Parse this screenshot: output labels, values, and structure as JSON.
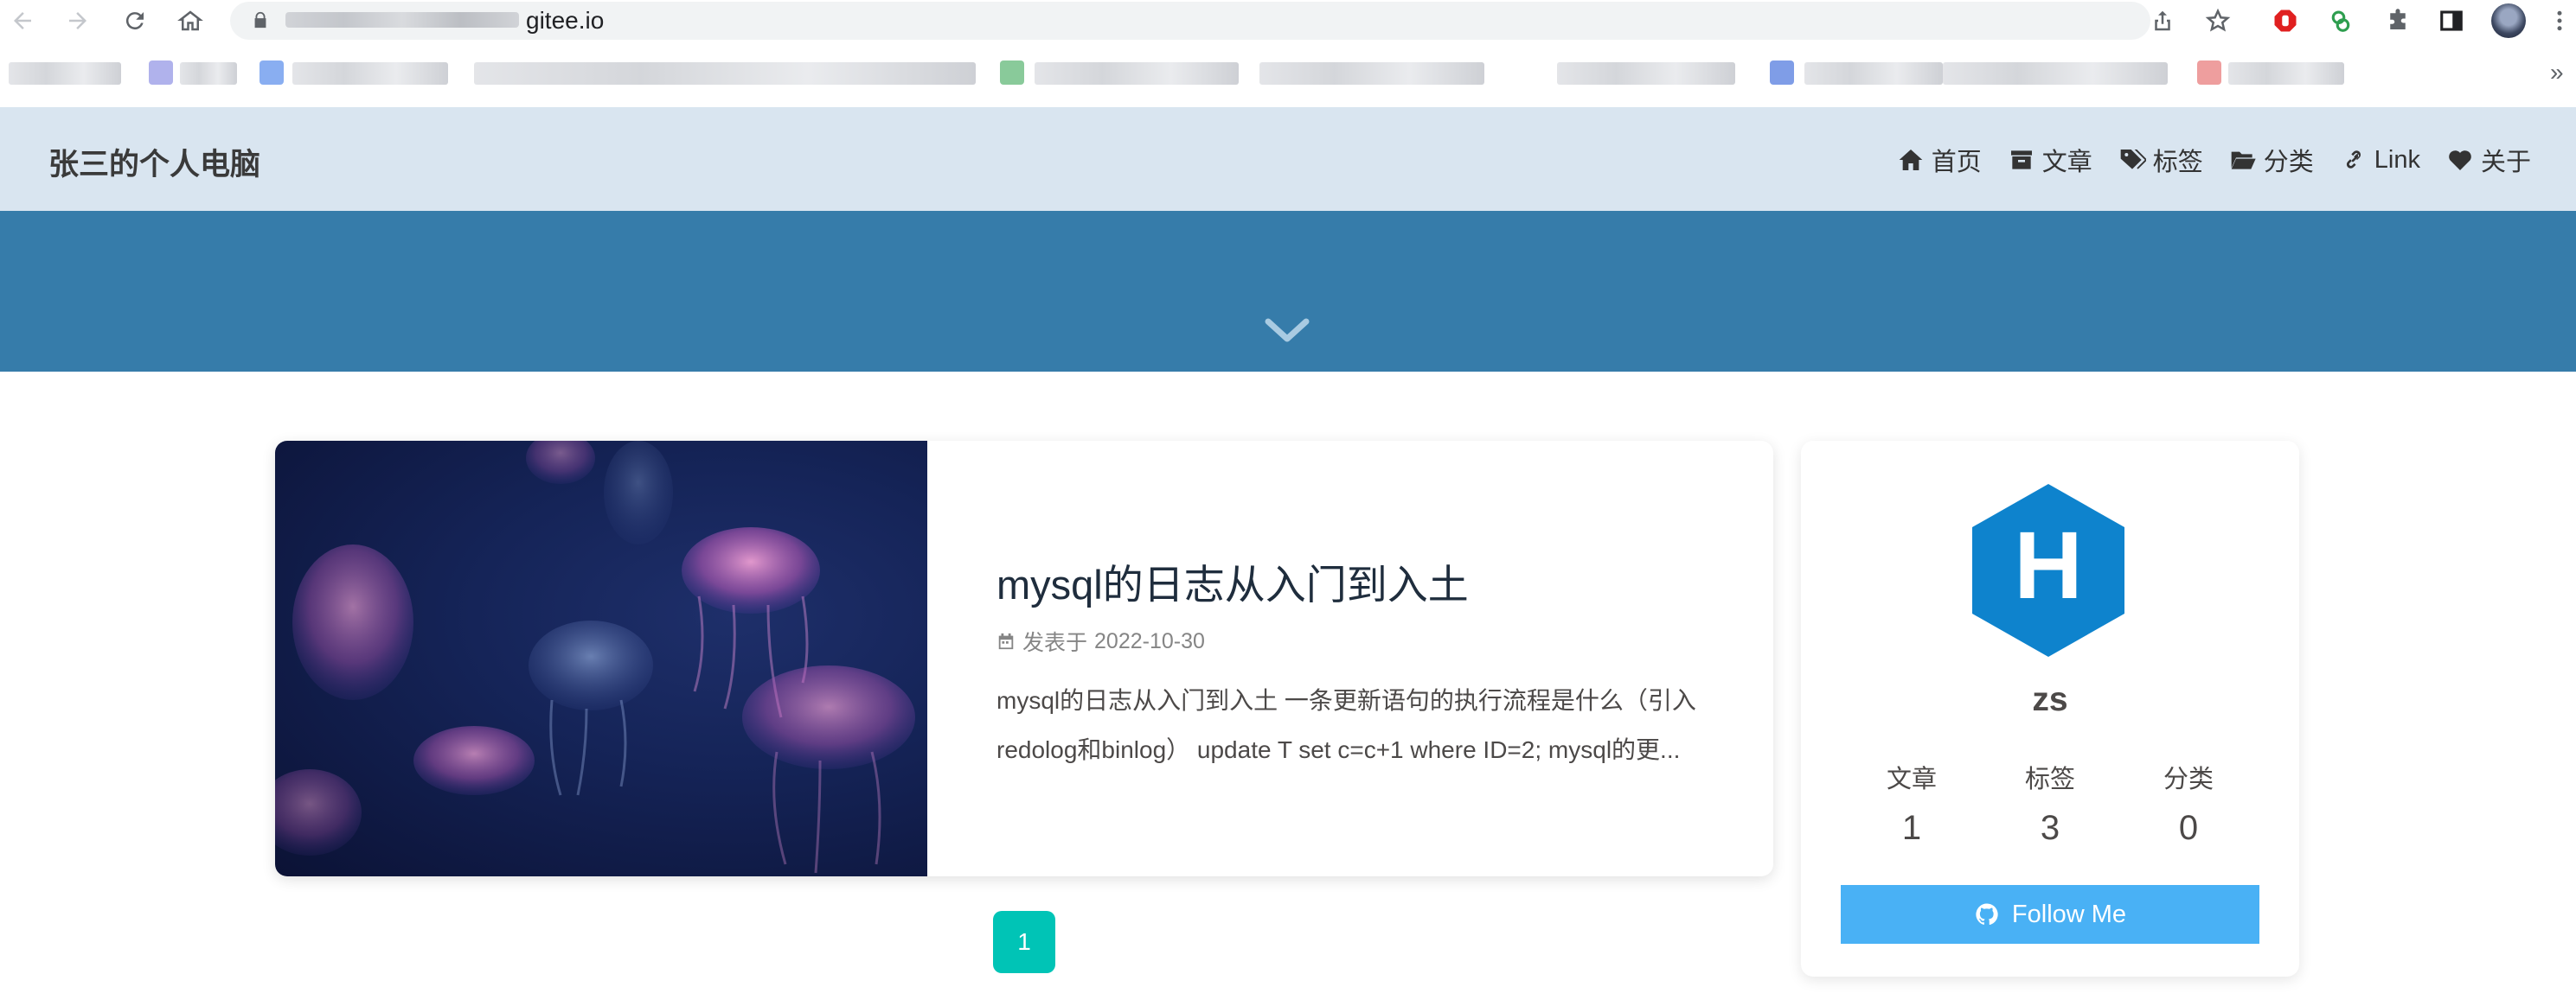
{
  "browser": {
    "url_domain": "gitee.io"
  },
  "site": {
    "title": "张三的个人电脑",
    "menu": [
      {
        "label": "首页",
        "icon": "home-icon"
      },
      {
        "label": "文章",
        "icon": "archive-icon"
      },
      {
        "label": "标签",
        "icon": "tags-icon"
      },
      {
        "label": "分类",
        "icon": "folder-open-icon"
      },
      {
        "label": "Link",
        "icon": "link-icon"
      },
      {
        "label": "关于",
        "icon": "heart-icon"
      }
    ]
  },
  "post": {
    "title": "mysql的日志从入门到入土",
    "meta_label": "发表于",
    "date": "2022-10-30",
    "excerpt": "mysql的日志从入门到入土 一条更新语句的执行流程是什么（引入redolog和binlog） update T set c=c+1 where ID=2; mysql的更..."
  },
  "pagination": {
    "current": "1"
  },
  "author": {
    "avatar_letter": "H",
    "name": "zs",
    "stats": [
      {
        "label": "文章",
        "value": "1"
      },
      {
        "label": "标签",
        "value": "3"
      },
      {
        "label": "分类",
        "value": "0"
      }
    ],
    "follow_label": "Follow Me"
  },
  "colors": {
    "header_bg": "#d9e5f0",
    "banner_bg": "#367caa",
    "accent_teal": "#00c4b6",
    "follow_blue": "#49b1f5",
    "avatar_blue": "#0e83cd"
  }
}
